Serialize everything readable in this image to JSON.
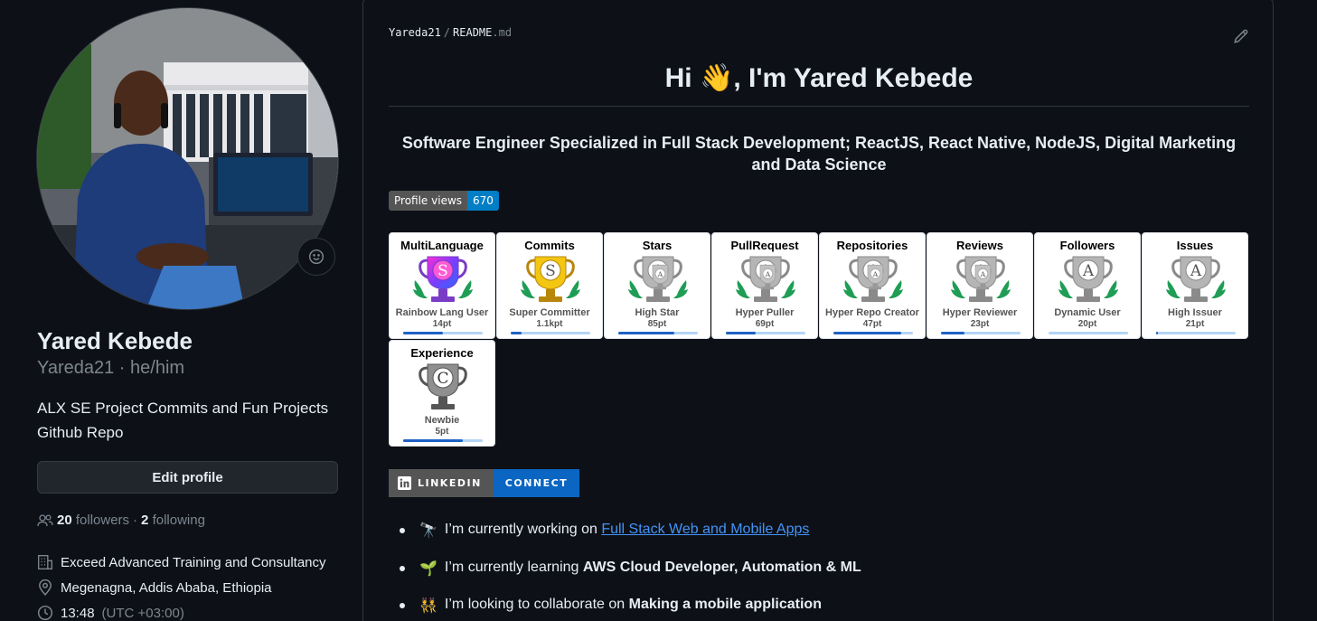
{
  "profile": {
    "name": "Yared Kebede",
    "login_pronouns": "Yareda21 · he/him",
    "bio": "ALX SE Project Commits and Fun Projects Github Repo",
    "edit_button": "Edit profile",
    "followers_count": "20",
    "followers_label": "followers",
    "separator": "·",
    "following_count": "2",
    "following_label": "following",
    "company": "Exceed Advanced Training and Consultancy",
    "location": "Megenagna, Addis Ababa, Ethiopia",
    "local_time": "13:48",
    "timezone": "(UTC +03:00)"
  },
  "readme": {
    "path_user": "Yareda21",
    "path_sep": "/",
    "path_file": "README",
    "path_ext": ".md",
    "title_prefix": "Hi ",
    "title_emoji": "👋",
    "title_suffix": ", I'm Yared Kebede",
    "subtitle": "Software Engineer Specialized in Full Stack Development; ReactJS, React Native, NodeJS, Digital Marketing and Data Science",
    "views_label": "Profile views",
    "views_count": "670",
    "trophies": [
      {
        "title": "MultiLanguage",
        "rank_letter": "S",
        "rank": "Rainbow Lang User",
        "points": "14pt",
        "progress": 0.5,
        "style": "rainbow"
      },
      {
        "title": "Commits",
        "rank_letter": "S",
        "rank": "Super Committer",
        "points": "1.1kpt",
        "progress": 0.14,
        "style": "gold"
      },
      {
        "title": "Stars",
        "rank_letter": "A",
        "rank": "High Star",
        "points": "85pt",
        "progress": 0.7,
        "style": "silver-double"
      },
      {
        "title": "PullRequest",
        "rank_letter": "A",
        "rank": "Hyper Puller",
        "points": "69pt",
        "progress": 0.38,
        "style": "silver-double"
      },
      {
        "title": "Repositories",
        "rank_letter": "A",
        "rank": "Hyper Repo Creator",
        "points": "47pt",
        "progress": 0.85,
        "style": "silver-double"
      },
      {
        "title": "Reviews",
        "rank_letter": "A",
        "rank": "Hyper Reviewer",
        "points": "23pt",
        "progress": 0.3,
        "style": "silver-double"
      },
      {
        "title": "Followers",
        "rank_letter": "A",
        "rank": "Dynamic User",
        "points": "20pt",
        "progress": 0.0,
        "style": "silver"
      },
      {
        "title": "Issues",
        "rank_letter": "A",
        "rank": "High Issuer",
        "points": "21pt",
        "progress": 0.02,
        "style": "silver"
      },
      {
        "title": "Experience",
        "rank_letter": "C",
        "rank": "Newbie",
        "points": "5pt",
        "progress": 0.75,
        "style": "dark"
      }
    ],
    "linkedin_label": "LINKEDIN",
    "linkedin_action": "CONNECT",
    "bullets": [
      {
        "emoji": "🔭",
        "text": "I’m currently working on ",
        "link": "Full Stack Web and Mobile Apps"
      },
      {
        "emoji": "🌱",
        "text": "I’m currently learning ",
        "bold": "AWS Cloud Developer, Automation & ML"
      },
      {
        "emoji": "👯",
        "text": "I’m looking to collaborate on ",
        "bold": "Making a mobile application"
      }
    ]
  },
  "colors": {
    "background": "#0d1117",
    "border": "#30363d",
    "text": "#e6edf3",
    "muted": "#7d8590",
    "link": "#4493f8",
    "badge_blue": "#007ec6",
    "linkedin_blue": "#0a66c2"
  },
  "icons": [
    "smiley-icon",
    "people-icon",
    "organization-icon",
    "location-icon",
    "clock-icon",
    "pencil-icon",
    "linkedin-icon"
  ]
}
